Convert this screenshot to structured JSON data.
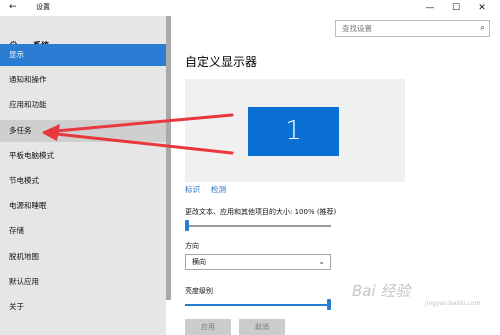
{
  "window": {
    "back_glyph": "←",
    "title": "设置",
    "minimize_glyph": "—",
    "maximize_glyph": "☐",
    "close_glyph": "✕"
  },
  "sidebar": {
    "home_icon": "gear-icon",
    "home_label": "系统",
    "items": [
      {
        "label": "显示",
        "state": "selected"
      },
      {
        "label": "通知和操作",
        "state": "normal"
      },
      {
        "label": "应用和功能",
        "state": "normal"
      },
      {
        "label": "多任务",
        "state": "hover"
      },
      {
        "label": "平板电脑模式",
        "state": "normal"
      },
      {
        "label": "节电模式",
        "state": "normal"
      },
      {
        "label": "电源和睡眠",
        "state": "normal"
      },
      {
        "label": "存储",
        "state": "normal"
      },
      {
        "label": "脱机地图",
        "state": "normal"
      },
      {
        "label": "默认应用",
        "state": "normal"
      },
      {
        "label": "关于",
        "state": "normal"
      }
    ]
  },
  "search": {
    "placeholder": "查找设置",
    "icon": "search-icon"
  },
  "main": {
    "title": "自定义显示器",
    "monitor_number": "1",
    "identify_link": "标识",
    "detect_link": "检测",
    "scale_label": "更改文本、应用和其他项目的大小: 100% (推荐)",
    "scale_level": 0,
    "orientation_label": "方向",
    "orientation_value": "横向",
    "brightness_label": "亮度级别",
    "brightness_level": 1.0,
    "apply_button": "应用",
    "cancel_button": "取消"
  },
  "watermark": {
    "text": "Bai 经验",
    "sub": "jingyan.baidu.com"
  },
  "colors": {
    "accent": "#2b7cd3",
    "annotation_arrow": "#e8383d"
  }
}
